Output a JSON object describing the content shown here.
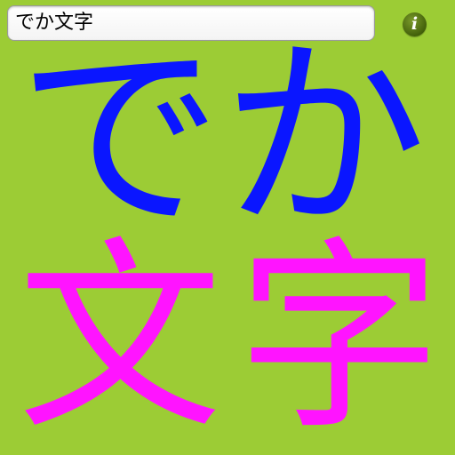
{
  "input": {
    "value": "でか文字"
  },
  "info_button": {
    "glyph": "i"
  },
  "display": {
    "background_color": "#9ccc35",
    "top_color": "#0a16ff",
    "bottom_color": "#ff14ff",
    "chars": [
      "で",
      "か",
      "文",
      "字"
    ]
  }
}
